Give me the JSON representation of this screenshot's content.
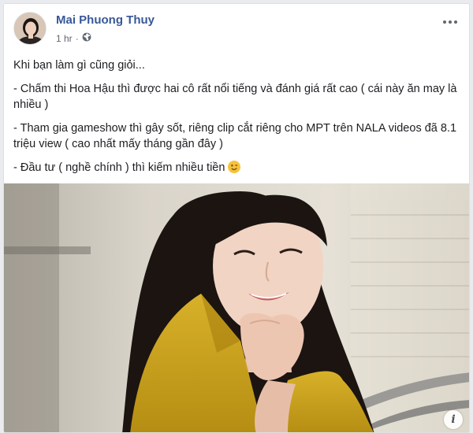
{
  "post": {
    "author": "Mai Phuong Thuy",
    "time": "1 hr",
    "privacy_icon": "globe-icon",
    "menu_icon": "more-horizontal-icon",
    "paragraphs": [
      "Khi bạn làm gì cũng giỏi...",
      "- Chấm thi Hoa Hậu thì được hai cô rất nổi tiếng và đánh giá rất cao ( cái này ăn may là nhiều )",
      "- Tham gia gameshow thì gây sốt, riêng clip cắt riêng cho MPT trên NALA videos đã 8.1 triệu view ( cao nhất mấy tháng gần đây )",
      "- Đầu tư ( nghề chính ) thì kiếm nhiều tiền"
    ],
    "emoji": "winking-face-emoji",
    "photo_info": "i",
    "colors": {
      "name": "#385898",
      "jacket": "#c9a21f",
      "hair": "#1a1210",
      "skin": "#f0d3c2"
    }
  }
}
